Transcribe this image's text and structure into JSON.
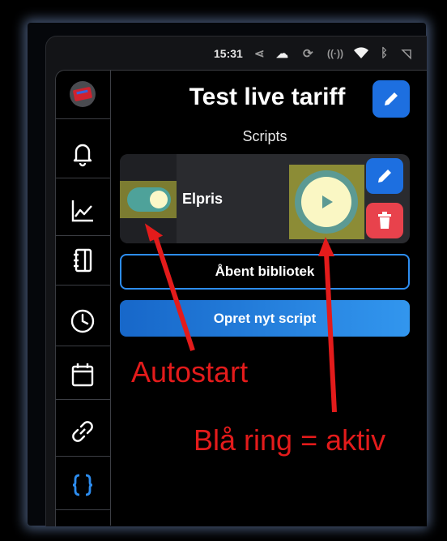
{
  "status_bar": {
    "time": "15:31",
    "icons": [
      "share-icon",
      "cloud-icon",
      "sync-icon",
      "radio-icon",
      "wifi-icon",
      "bluetooth-icon",
      "cast-icon"
    ]
  },
  "sidebar": {
    "items": [
      {
        "name": "app-logo",
        "icon": "logo-icon",
        "active": false
      },
      {
        "name": "alerts",
        "icon": "bell-icon",
        "active": false
      },
      {
        "name": "charts",
        "icon": "chart-icon",
        "active": false
      },
      {
        "name": "notebook",
        "icon": "notebook-icon",
        "active": false
      },
      {
        "name": "history",
        "icon": "clock-icon",
        "active": false
      },
      {
        "name": "calendar",
        "icon": "calendar-icon",
        "active": false
      },
      {
        "name": "links",
        "icon": "link-icon",
        "active": false
      },
      {
        "name": "scripts",
        "icon": "braces-icon",
        "active": true
      }
    ],
    "active_color": "#2d8df0"
  },
  "header": {
    "title": "Test live tariff",
    "subtitle": "Scripts",
    "edit_icon": "pencil-icon"
  },
  "scripts": [
    {
      "name": "Elpris",
      "autostart": true,
      "running": true,
      "edit_icon": "pencil-icon",
      "delete_icon": "trash-icon",
      "play_icon": "play-icon"
    }
  ],
  "buttons": {
    "open_library": "Åbent bibliotek",
    "create_script": "Opret nyt script"
  },
  "annotations": {
    "autostart": "Autostart",
    "ring": "Blå ring = aktiv",
    "color": "#e31b1b"
  },
  "colors": {
    "accent": "#1d6fe0",
    "danger": "#e8424c",
    "toggle_on": "#4ea29a",
    "play_ring": "#5c9a93"
  }
}
